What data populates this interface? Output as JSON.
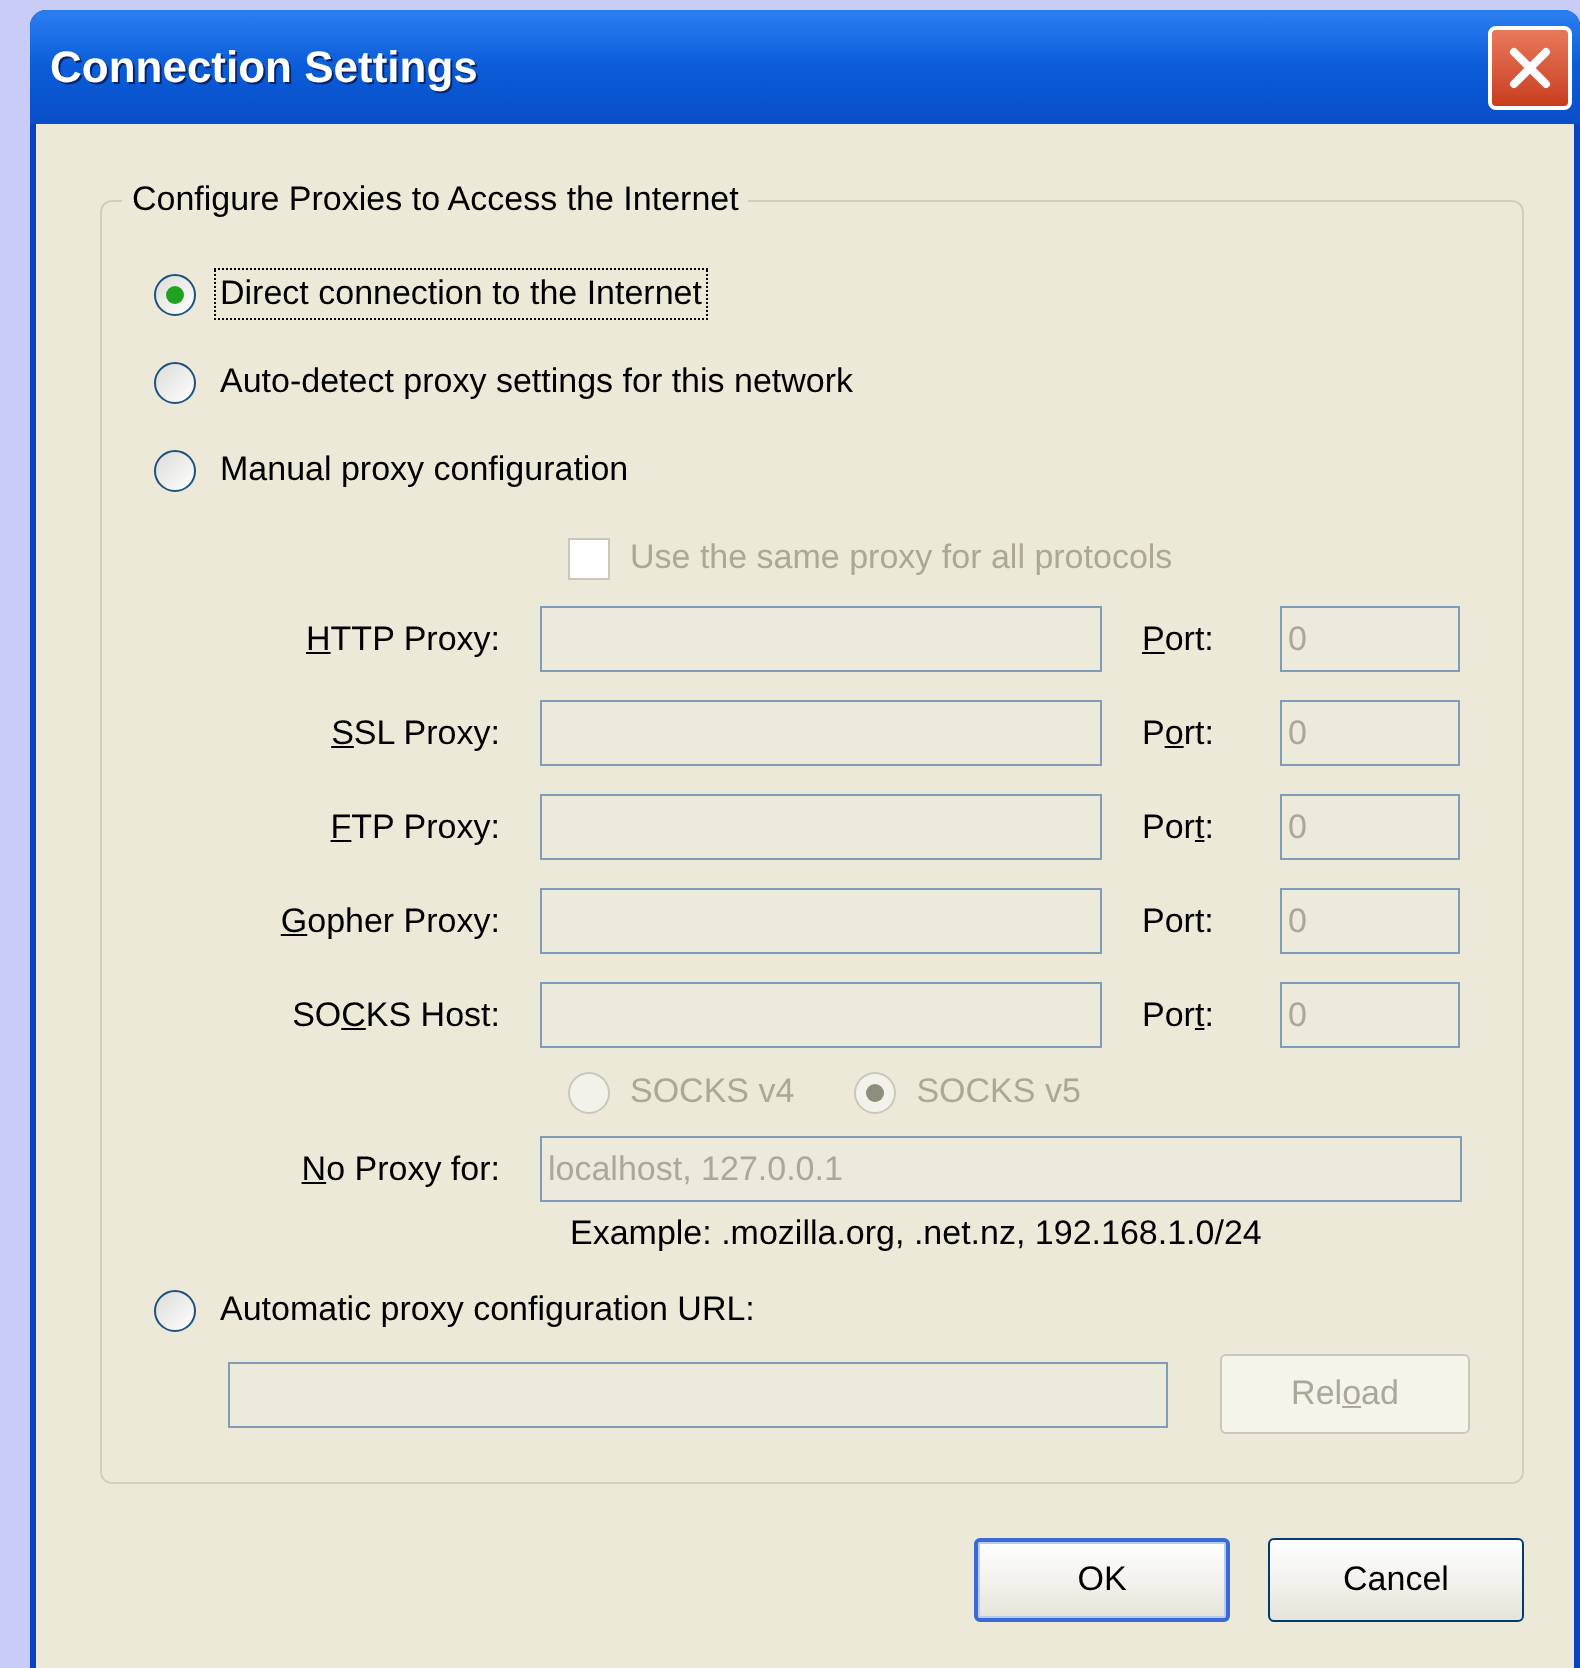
{
  "window": {
    "title": "Connection Settings"
  },
  "group": {
    "title": "Configure Proxies to Access the Internet"
  },
  "modes": [
    {
      "label": "Direct connection to the Internet",
      "selected": true,
      "focused": true
    },
    {
      "label": "Auto-detect proxy settings for this network",
      "selected": false,
      "focused": false
    },
    {
      "label": "Manual proxy configuration",
      "selected": false,
      "focused": false
    },
    {
      "label": "Automatic proxy configuration URL:",
      "selected": false,
      "focused": false
    }
  ],
  "same_proxy": {
    "label": "Use the same proxy for all protocols",
    "checked": false,
    "disabled": true
  },
  "proxies": [
    {
      "label": {
        "key": "H",
        "end": "TTP Proxy:"
      },
      "port_label": {
        "key": "P",
        "end": "ort:"
      },
      "port": "0",
      "disabled": true
    },
    {
      "label": {
        "key": "S",
        "end": "SL Proxy:"
      },
      "port_label": {
        "start": "P",
        "key": "o",
        "end": "rt:"
      },
      "port": "0",
      "disabled": true
    },
    {
      "label": {
        "key": "F",
        "end": "TP Proxy:"
      },
      "port_label": {
        "start": "Por",
        "key": "t",
        "end": ":"
      },
      "port": "0",
      "disabled": true
    },
    {
      "label": {
        "key": "G",
        "end": "opher Proxy:"
      },
      "port_label": {
        "start": "Port:"
      },
      "port": "0",
      "disabled": true
    },
    {
      "label": {
        "start": "SO",
        "key": "C",
        "end": "KS Host:"
      },
      "port_label": {
        "start": "Por",
        "key": "t",
        "end": ":"
      },
      "port": "0",
      "disabled": true
    }
  ],
  "socks_versions": [
    {
      "label": "SOCKS v4",
      "selected": false,
      "disabled": true
    },
    {
      "label": "SOCKS v5",
      "selected": true,
      "disabled": true
    }
  ],
  "no_proxy": {
    "label": {
      "key": "N",
      "end": "o Proxy for:"
    },
    "value": "localhost, 127.0.0.1",
    "disabled": true
  },
  "example": "Example: .mozilla.org, .net.nz, 192.168.1.0/24",
  "auto_url": {
    "disabled": true
  },
  "reload": {
    "label": {
      "start": "Rel",
      "key": "o",
      "end": "ad"
    },
    "disabled": true
  },
  "buttons": [
    {
      "label": "OK",
      "default": true
    },
    {
      "label": "Cancel",
      "default": false
    }
  ]
}
